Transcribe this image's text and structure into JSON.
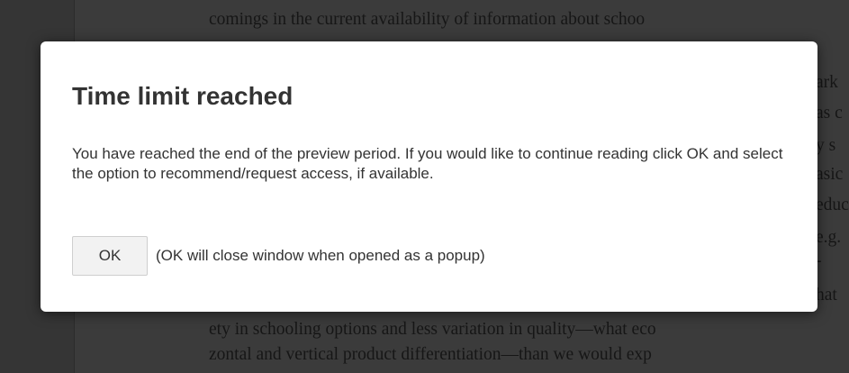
{
  "background_page": {
    "top_line": "comings in the current availability of information about schoo",
    "right_fragments": [
      "ark",
      "as c",
      "y s",
      "asic",
      "educ",
      "e.g.",
      "-",
      "hat"
    ],
    "bottom_lines": [
      "ety in schooling options and less variation in quality—what eco",
      "zontal and vertical product differentiation—than we would exp"
    ]
  },
  "dialog": {
    "title": "Time limit reached",
    "message": "You have reached the end of the preview period. If you would like to continue reading click OK and select the option to recommend/request access, if available.",
    "ok_label": "OK",
    "ok_note": "(OK will close window when opened as a popup)"
  }
}
